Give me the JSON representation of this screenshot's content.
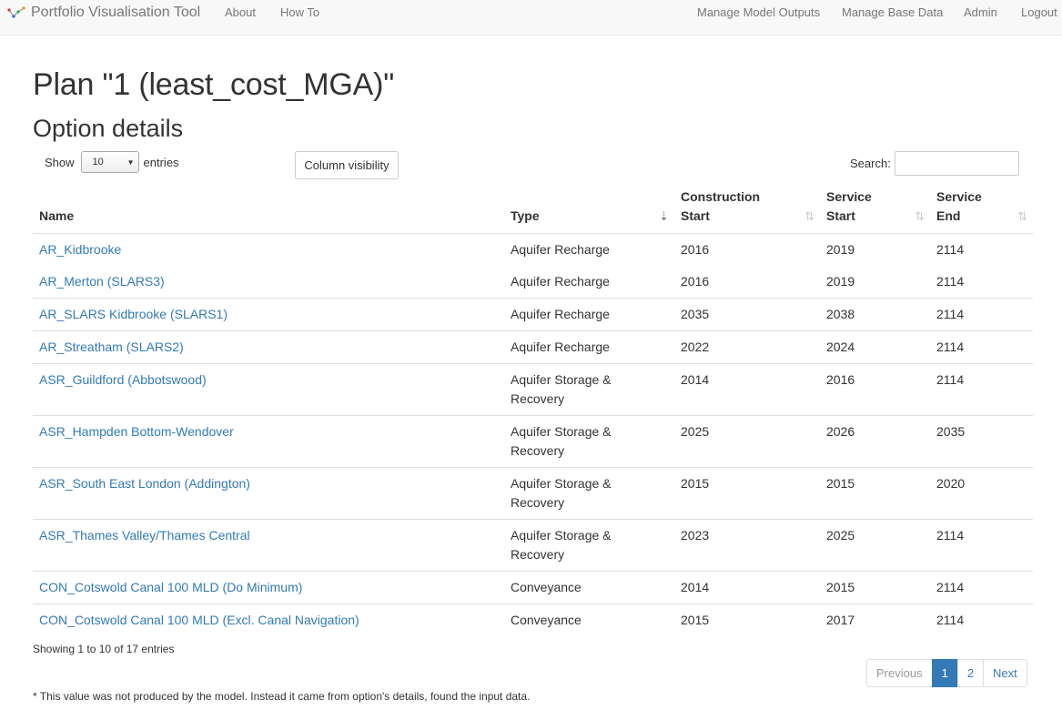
{
  "navbar": {
    "brand": "Portfolio Visualisation Tool",
    "left_links": [
      "About",
      "How To"
    ],
    "right_links": [
      "Manage Model Outputs",
      "Manage Base Data",
      "Admin",
      "Logout"
    ]
  },
  "page_title": "Plan \"1 (least_cost_MGA)\"",
  "section_title": "Option details",
  "controls": {
    "show_label": "Show",
    "entries_value": "10",
    "entries_label": "entries",
    "column_visibility": "Column visibility",
    "search_label": "Search:",
    "search_value": ""
  },
  "table": {
    "headers": [
      {
        "label": "Name",
        "sort": ""
      },
      {
        "label": "Type",
        "sort": "sort-desc"
      },
      {
        "label": "Construction Start",
        "sort": "sort-both"
      },
      {
        "label": "Service Start",
        "sort": "sort-both"
      },
      {
        "label": "Service End",
        "sort": "sort-both"
      }
    ],
    "rows": [
      {
        "name": "AR_Kidbrooke",
        "type": "Aquifer Recharge",
        "construction_start": "2016",
        "service_start": "2019",
        "service_end": "2114"
      },
      {
        "name": "AR_Merton (SLARS3)",
        "type": "Aquifer Recharge",
        "construction_start": "2016",
        "service_start": "2019",
        "service_end": "2114"
      },
      {
        "name": "AR_SLARS Kidbrooke (SLARS1)",
        "type": "Aquifer Recharge",
        "construction_start": "2035",
        "service_start": "2038",
        "service_end": "2114"
      },
      {
        "name": "AR_Streatham (SLARS2)",
        "type": "Aquifer Recharge",
        "construction_start": "2022",
        "service_start": "2024",
        "service_end": "2114"
      },
      {
        "name": "ASR_Guildford (Abbotswood)",
        "type": "Aquifer Storage & Recovery",
        "construction_start": "2014",
        "service_start": "2016",
        "service_end": "2114"
      },
      {
        "name": "ASR_Hampden Bottom-Wendover",
        "type": "Aquifer Storage & Recovery",
        "construction_start": "2025",
        "service_start": "2026",
        "service_end": "2035"
      },
      {
        "name": "ASR_South East London (Addington)",
        "type": "Aquifer Storage & Recovery",
        "construction_start": "2015",
        "service_start": "2015",
        "service_end": "2020"
      },
      {
        "name": "ASR_Thames Valley/Thames Central",
        "type": "Aquifer Storage & Recovery",
        "construction_start": "2023",
        "service_start": "2025",
        "service_end": "2114"
      },
      {
        "name": "CON_Cotswold Canal 100 MLD (Do Minimum)",
        "type": "Conveyance",
        "construction_start": "2014",
        "service_start": "2015",
        "service_end": "2114"
      },
      {
        "name": "CON_Cotswold Canal 100 MLD (Excl. Canal Navigation)",
        "type": "Conveyance",
        "construction_start": "2015",
        "service_start": "2017",
        "service_end": "2114"
      }
    ]
  },
  "info": "Showing 1 to 10 of 17 entries",
  "pagination": {
    "previous": "Previous",
    "pages": [
      "1",
      "2"
    ],
    "active_page": "1",
    "next": "Next"
  },
  "footnote": "* This value was not produced by the model. Instead it came from option's details, found the input data.",
  "colors": {
    "link": "#337ab7",
    "navbar_bg": "#f8f8f8",
    "active_page_bg": "#337ab7"
  }
}
